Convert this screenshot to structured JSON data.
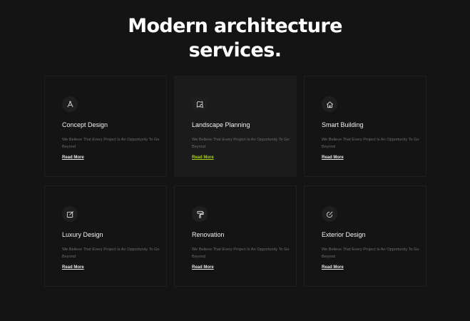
{
  "heading": {
    "line1": "Modern architecture",
    "line2": "services."
  },
  "services": [
    {
      "icon": "compass-ruler-icon",
      "title": "Concept Design",
      "description": "We Believe That Every Project Is An Opportunity To Go Beyond",
      "link": "Read More"
    },
    {
      "icon": "map-search-icon",
      "title": "Landscape Planning",
      "description": "We Believe That Every Project Is An Opportunity To Go Beyond",
      "link": "Read More",
      "active": true
    },
    {
      "icon": "smart-home-icon",
      "title": "Smart Building",
      "description": "We Believe That Every Project Is An Opportunity To Go Beyond",
      "link": "Read More"
    },
    {
      "icon": "pencil-square-icon",
      "title": "Luxury Design",
      "description": "We Believe That Every Project Is An Opportunity To Go Beyond",
      "link": "Read More"
    },
    {
      "icon": "paint-roller-icon",
      "title": "Renovation",
      "description": "We Believe That Every Project Is An Opportunity To Go Beyond",
      "link": "Read More"
    },
    {
      "icon": "edit-circle-icon",
      "title": "Exterior Design",
      "description": "We Believe That Every Project Is An Opportunity To Go Beyond",
      "link": "Read More"
    }
  ],
  "colors": {
    "background": "#141414",
    "card_active": "#1b1b1b",
    "accent": "#a6d316",
    "text_muted": "#6e6e6e"
  }
}
